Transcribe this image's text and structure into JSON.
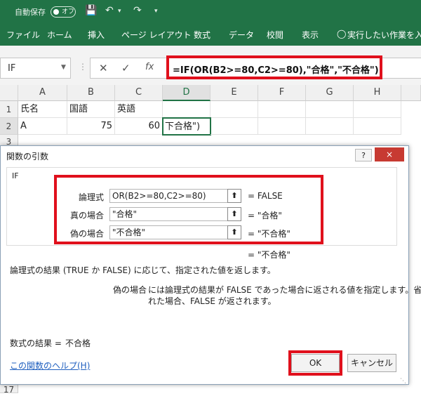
{
  "titlebar": {
    "autosave_label": "自動保存",
    "toggle_state": "オフ"
  },
  "ribbon": {
    "tabs": [
      "ファイル",
      "ホーム",
      "挿入",
      "ページ レイアウト",
      "数式",
      "データ",
      "校閲",
      "表示"
    ],
    "tell_me": "実行したい作業を入力"
  },
  "formula_bar": {
    "name_box": "IF",
    "fx": "fx",
    "formula": "=IF(OR(B2>=80,C2>=80),\"合格\",\"不合格\")"
  },
  "sheet": {
    "columns": [
      "A",
      "B",
      "C",
      "D",
      "E",
      "F",
      "G",
      "H"
    ],
    "rows": [
      "1",
      "2",
      "3",
      "17"
    ],
    "cells": {
      "A1": "氏名",
      "B1": "国語",
      "C1": "英語",
      "A2": "A",
      "B2": "75",
      "C2": "60",
      "D2": "下合格\")"
    }
  },
  "dialog": {
    "title": "関数の引数",
    "help_btn": "?",
    "close_btn": "×",
    "function_name": "IF",
    "args": [
      {
        "label": "論理式",
        "value": "OR(B2>=80,C2>=80)",
        "result": "= FALSE"
      },
      {
        "label": "真の場合",
        "value": "\"合格\"",
        "result": "= \"合格\""
      },
      {
        "label": "偽の場合",
        "value": "\"不合格\"",
        "result": "= \"不合格\""
      }
    ],
    "overall_result": "= \"不合格\"",
    "description": "論理式の結果 (TRUE か FALSE) に応じて、指定された値を返します。",
    "arg_help_name": "偽の場合",
    "arg_help_text": "には論理式の結果が FALSE であった場合に返される値を指定します。省略さ",
    "arg_help_text2": "れた場合、FALSE が返されます。",
    "result_label": "数式の結果 =",
    "result_value": "不合格",
    "help_link": "この関数のヘルプ(H)",
    "ok": "OK",
    "cancel": "キャンセル"
  }
}
